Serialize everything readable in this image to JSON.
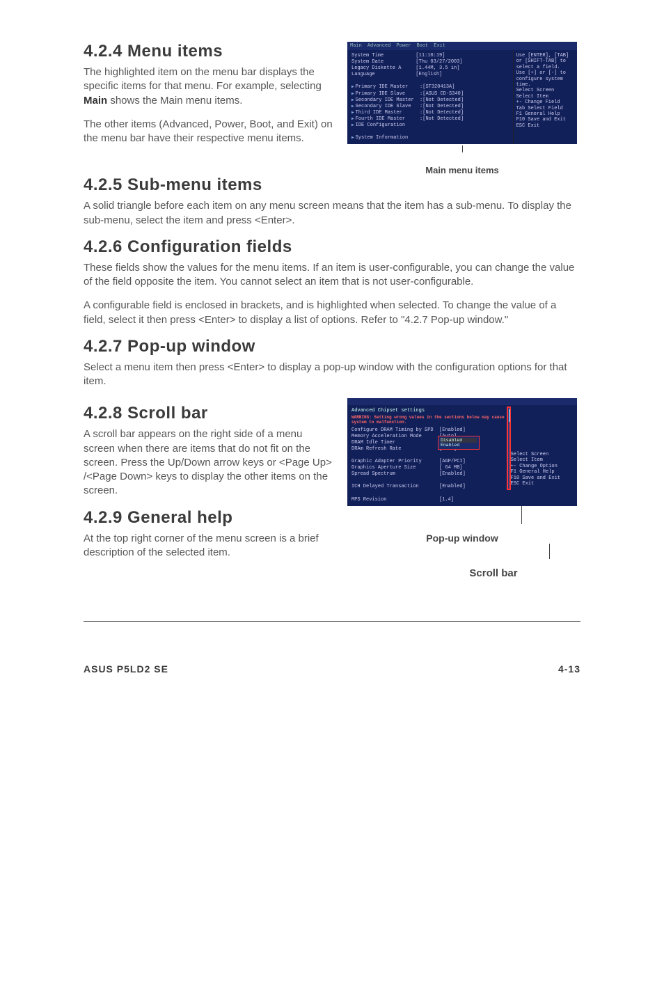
{
  "sections": {
    "s424": {
      "heading": "4.2.4  Menu items",
      "p1": "The highlighted item on the menu bar displays the specific items for that menu. For example, selecting ",
      "p1b": "Main",
      "p1c": " shows the Main menu items.",
      "p2": "The other items (Advanced, Power, Boot, and Exit) on the menu bar have their respective menu items."
    },
    "s425": {
      "heading": "4.2.5  Sub-menu items",
      "p1": "A solid triangle before each item on any menu screen means that the item has a sub-menu. To display the sub-menu, select the item and press <Enter>."
    },
    "s426": {
      "heading": "4.2.6  Configuration fields",
      "p1": "These fields show the values for the menu items. If an item is user-configurable, you can change the value of the field opposite the item. You cannot select an item that is not user-configurable.",
      "p2": "A configurable field is enclosed in brackets, and is highlighted when selected. To change the value of a field, select it then press <Enter> to display a list of options. Refer to \"4.2.7 Pop-up window.\""
    },
    "s427": {
      "heading": "4.2.7  Pop-up window",
      "p1": "Select a menu item then press <Enter> to display a pop-up window with the configuration options for that item."
    },
    "s428": {
      "heading": "4.2.8  Scroll bar",
      "p1": "A scroll bar appears on the right side of a menu screen when there are items that do not fit on the screen. Press the Up/Down arrow keys or <Page Up> /<Page Down> keys to display the other items on the screen."
    },
    "s429": {
      "heading": "4.2.9  General help",
      "p1": "At the top right corner of the menu screen is a brief description of the selected item."
    }
  },
  "bios1": {
    "tabs": [
      "Main",
      "Advanced",
      "Power",
      "Boot",
      "Exit"
    ],
    "caption": "Main menu items",
    "left": [
      {
        "l": "System Time",
        "v": "[11:10:19]"
      },
      {
        "l": "System Date",
        "v": "[Thu 03/27/2003]"
      },
      {
        "l": "Legacy Diskette A",
        "v": "[1.44M, 3.5 in]"
      },
      {
        "l": "Language",
        "v": "[English]"
      },
      {
        "l": "",
        "v": ""
      },
      {
        "l": "Primary IDE Master",
        "v": ":[ST320413A]",
        "tri": true
      },
      {
        "l": "Primary IDE Slave",
        "v": ":[ASUS CD-S340]",
        "tri": true
      },
      {
        "l": "Secondary IDE Master",
        "v": ":[Not Detected]",
        "tri": true
      },
      {
        "l": "Secondary IDE Slave",
        "v": ":[Not Detected]",
        "tri": true
      },
      {
        "l": "Third IDE Master",
        "v": ":[Not Detected]",
        "tri": true
      },
      {
        "l": "Fourth IDE Master",
        "v": ":[Not Detected]",
        "tri": true
      },
      {
        "l": "IDE Configuration",
        "v": "",
        "tri": true
      },
      {
        "l": "",
        "v": ""
      },
      {
        "l": "System Information",
        "v": "",
        "tri": true
      }
    ],
    "right": [
      "Use [ENTER], [TAB]",
      "or [SHIFT-TAB] to",
      "select a field.",
      "",
      "Use [+] or [-] to",
      "configure system time.",
      "",
      "",
      "",
      "    Select Screen",
      "    Select Item",
      "+-  Change Field",
      "Tab Select Field",
      "F1  General Help",
      "F10 Save and Exit",
      "ESC Exit"
    ]
  },
  "bios2": {
    "title": "Advanced Chipset settings",
    "warning": "WARNING: Setting wrong values in the sections below may cause system to malfunction.",
    "rows": [
      {
        "l": "Configure DRAM Timing by SPD",
        "v": "[Enabled]"
      },
      {
        "l": "Memory Acceleration Mode",
        "v": "[Auto]"
      },
      {
        "l": "DRAM Idle Timer",
        "v": "[Auto]"
      },
      {
        "l": "DRAm Refresh Rate",
        "v": "[Auto]"
      },
      {
        "l": "",
        "v": ""
      },
      {
        "l": "Graphic Adapter Priority",
        "v": "[AGP/PCI]"
      },
      {
        "l": "Graphics Aperture Size",
        "v": "[ 64 MB]"
      },
      {
        "l": "Spread Spectrum",
        "v": "[Enabled]"
      },
      {
        "l": "",
        "v": ""
      },
      {
        "l": "ICH Delayed Transaction",
        "v": "[Enabled]"
      },
      {
        "l": "",
        "v": ""
      },
      {
        "l": "MPS Revision",
        "v": "[1.4]"
      }
    ],
    "popup": [
      "Disabled",
      "Enabled"
    ],
    "right": [
      "    Select Screen",
      "    Select Item",
      "+-  Change Option",
      "F1  General Help",
      "F10 Save and Exit",
      "ESC Exit"
    ],
    "caption1": "Pop-up window",
    "caption2": "Scroll bar"
  },
  "footer": {
    "left": "ASUS P5LD2 SE",
    "right": "4-13"
  }
}
